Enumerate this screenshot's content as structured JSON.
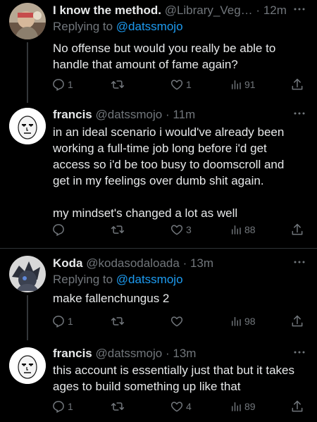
{
  "colors": {
    "background": "#000000",
    "text": "#e7e9ea",
    "muted": "#71767b",
    "link": "#1d9bf0",
    "divider": "#2f3336"
  },
  "tweets": [
    {
      "name": "I know the method.",
      "handle": "@Library_Veg…",
      "dot": "·",
      "time": "12m",
      "reply_prefix": "Replying to",
      "reply_to": "@datssmojo",
      "text": [
        "No offense but would you really be able to handle that amount of fame again?"
      ],
      "replies": "1",
      "reposts": "",
      "likes": "1",
      "views": "91"
    },
    {
      "name": "francis",
      "handle": "@datssmojo",
      "dot": "·",
      "time": "11m",
      "text": [
        "in an ideal scenario i would've already been working a full-time job long before i'd get access so i'd be too busy to doomscroll and get in my feelings over dumb shit again.",
        "my mindset's changed a lot as well"
      ],
      "replies": "",
      "reposts": "",
      "likes": "3",
      "views": "88"
    },
    {
      "name": "Koda",
      "handle": "@kodasodaloada",
      "dot": "·",
      "time": "13m",
      "reply_prefix": "Replying to",
      "reply_to": "@datssmojo",
      "text": [
        "make fallenchungus 2"
      ],
      "replies": "1",
      "reposts": "",
      "likes": "",
      "views": "98"
    },
    {
      "name": "francis",
      "handle": "@datssmojo",
      "dot": "·",
      "time": "13m",
      "text": [
        "this account is essentially just that but it takes ages to build something up like that"
      ],
      "replies": "1",
      "reposts": "",
      "likes": "4",
      "views": "89"
    }
  ],
  "icons": {
    "more": "more-dots-icon",
    "reply": "reply-icon",
    "repost": "repost-icon",
    "like": "like-icon",
    "views": "views-icon",
    "share": "share-icon"
  }
}
